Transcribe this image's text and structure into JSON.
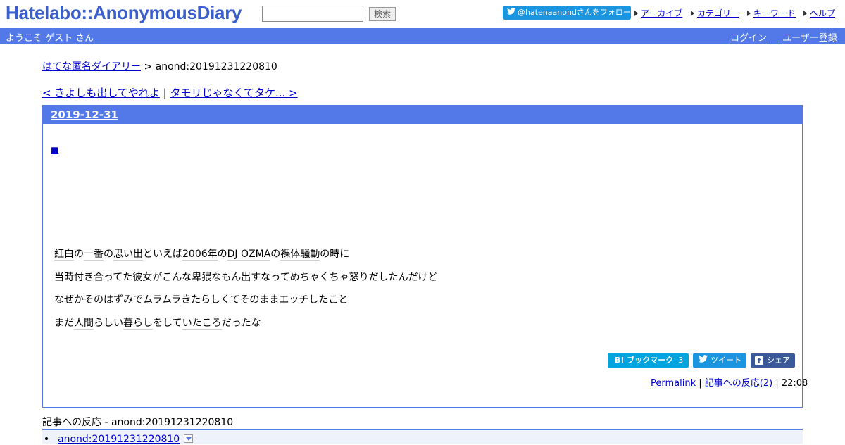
{
  "header": {
    "logo": "Hatelabo::AnonymousDiary",
    "search_placeholder": "",
    "search_button": "検索",
    "follow_button": "@hatenaanondさんをフォロー",
    "nav": [
      "アーカイブ",
      "カテゴリー",
      "キーワード",
      "ヘルプ"
    ]
  },
  "bluebar": {
    "welcome": "ようこそ ゲスト さん",
    "login": "ログイン",
    "register": "ユーザー登録"
  },
  "breadcrumb": {
    "home": "はてな匿名ダイアリー",
    "separator": " > ",
    "current": "anond:20191231220810"
  },
  "prevnext": {
    "prev": "< きよしも出してやれよ",
    "separator": " | ",
    "next": "タモリじゃなくてタケ... >"
  },
  "entry": {
    "date": "2019-12-31",
    "square": "■",
    "lines": [
      [
        "紅白",
        "の",
        "一番",
        "の",
        "思い出",
        "といえば",
        "2006年",
        "の",
        "DJ OZMA",
        "の",
        "裸体",
        "騒動",
        "の時に"
      ],
      [
        "当時付き合ってた彼女がこんな卑猥なもん出すなってめちゃくちゃ怒りだしたんだけど"
      ],
      [
        "なぜかそのはずみで",
        "ムラムラ",
        "きたらしくてそのまま",
        "エッチしたこと"
      ],
      [
        "まだ",
        "人間",
        "らしい",
        "暮らし",
        "をして",
        "いたころ",
        "だったな"
      ]
    ],
    "share": {
      "hatebu_label": "B! ブックマーク",
      "hatebu_count": "3",
      "tweet": "ツイート",
      "fb": "シェア"
    },
    "meta": {
      "permalink": "Permalink",
      "sep1": " | ",
      "reactions": "記事への反応(2)",
      "sep2": " | ",
      "time": "22:08"
    }
  },
  "reactions": {
    "title": "記事への反応 - anond:20191231220810",
    "items": [
      "anond:20191231220810"
    ]
  },
  "colors": {
    "accent": "#5279e7",
    "logo": "#3a5fcd",
    "link": "#0000cc",
    "twitter": "#1b95e0",
    "hatebu": "#00a4de",
    "facebook": "#3b5998"
  }
}
